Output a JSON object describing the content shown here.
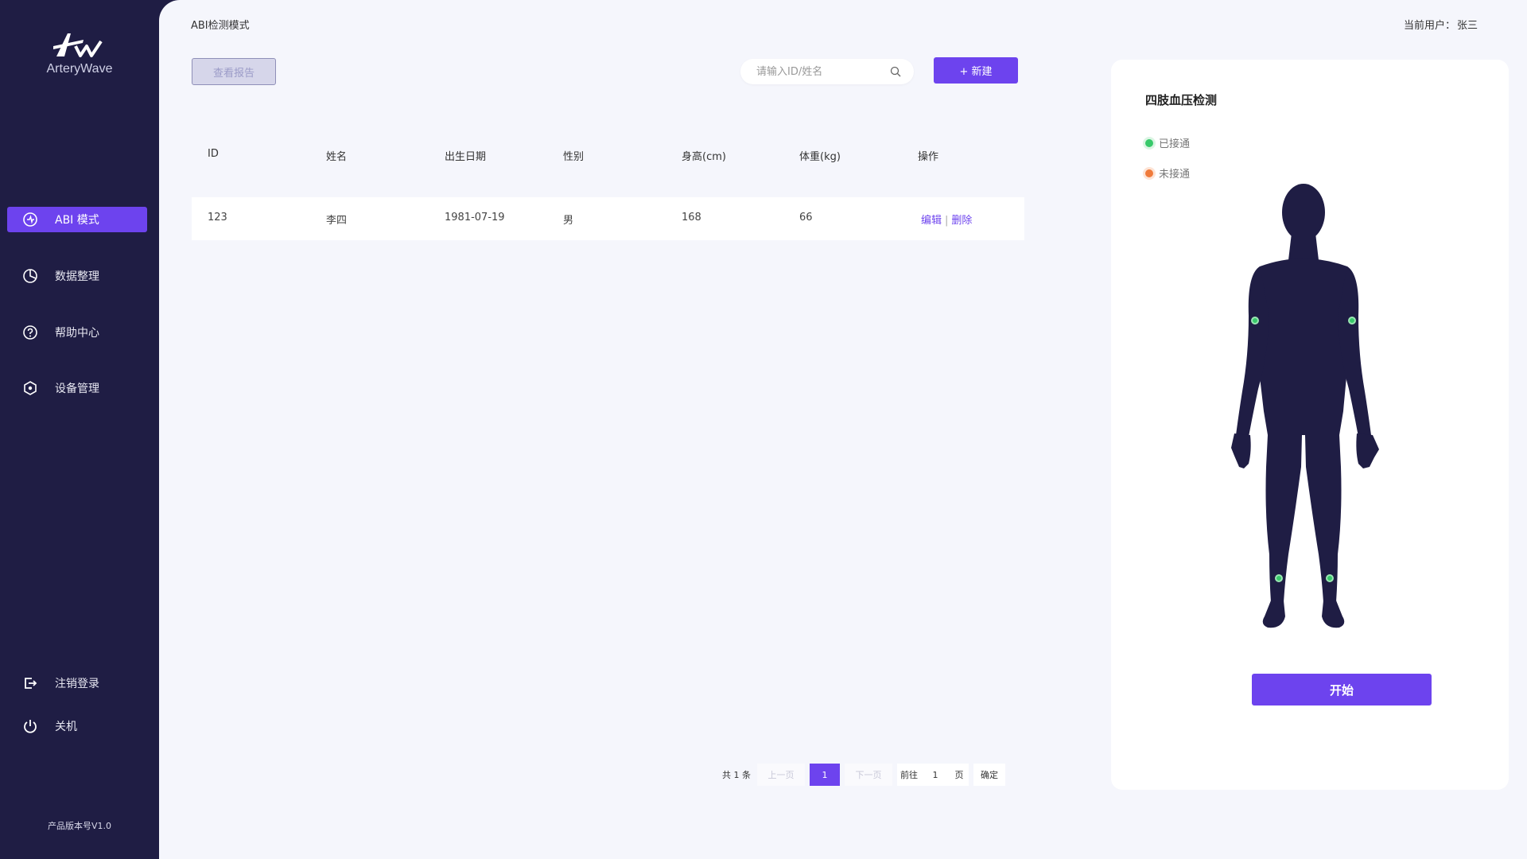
{
  "app": {
    "logo_text": "ArteryWave",
    "version": "产品版本号V1.0"
  },
  "sidebar": {
    "items": [
      {
        "label": "ABI 模式",
        "icon": "abi-mode-icon"
      },
      {
        "label": "数据整理",
        "icon": "pie-chart-icon"
      },
      {
        "label": "帮助中心",
        "icon": "help-circle-icon"
      },
      {
        "label": "设备管理",
        "icon": "device-hexagon-icon"
      },
      {
        "label": "注销登录",
        "icon": "logout-icon"
      },
      {
        "label": "关机",
        "icon": "power-icon"
      }
    ]
  },
  "header": {
    "breadcrumb": "ABI检测模式",
    "user_label": "当前用户：",
    "user_name": "张三"
  },
  "toolbar": {
    "report_label": "查看报告",
    "search_placeholder": "请输入ID/姓名",
    "new_label": "+ 新建"
  },
  "table": {
    "headers": [
      "ID",
      "姓名",
      "出生日期",
      "性别",
      "身高(cm)",
      "体重(kg)",
      "操作"
    ],
    "rows": [
      {
        "id": "123",
        "name": "李四",
        "dob": "1981-07-19",
        "sex": "男",
        "height": "168",
        "weight": "66",
        "edit": "编辑",
        "delete": "删除"
      }
    ]
  },
  "pagination": {
    "total": "共 1 条",
    "prev": "上一页",
    "current": "1",
    "next": "下一页",
    "goto": "前往",
    "page_value": "1",
    "page_unit": "页",
    "confirm": "确定"
  },
  "panel": {
    "title": "四肢血压检测",
    "legend": [
      {
        "label": "已接通",
        "color": "#38c96a"
      },
      {
        "label": "未接通",
        "color": "#f07a3a"
      }
    ],
    "start_label": "开始"
  },
  "colors": {
    "accent": "#6d43ee",
    "sidebar_bg": "#1f1d44",
    "main_bg": "#f5f6fc",
    "figure": "#1f1d44"
  }
}
